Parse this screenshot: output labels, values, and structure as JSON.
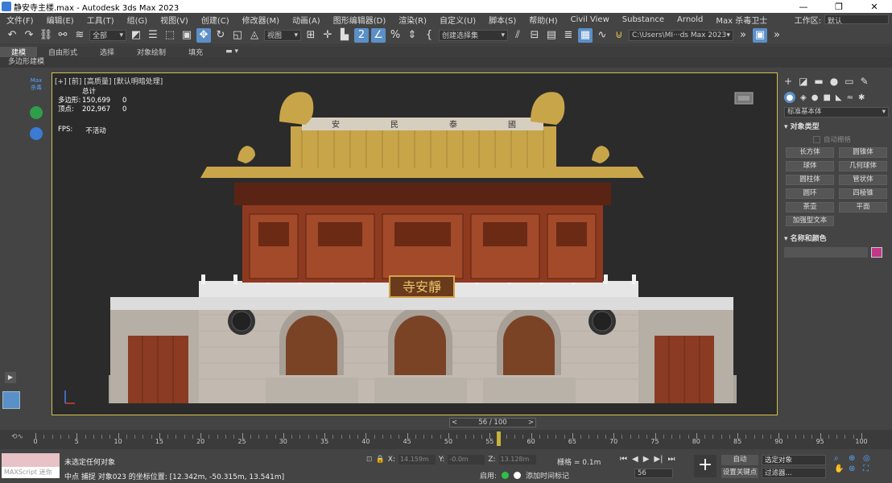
{
  "window": {
    "title": "静安寺主楼.max - Autodesk 3ds Max 2023",
    "controls": [
      "—",
      "❐",
      "✕"
    ]
  },
  "menu": {
    "items": [
      "文件(F)",
      "编辑(E)",
      "工具(T)",
      "组(G)",
      "视图(V)",
      "创建(C)",
      "修改器(M)",
      "动画(A)",
      "图形编辑器(D)",
      "渲染(R)",
      "自定义(U)",
      "脚本(S)",
      "帮助(H)",
      "Civil View",
      "Substance",
      "Arnold",
      "Max 杀毒卫士"
    ],
    "workspace_label": "工作区:",
    "workspace_value": "默认"
  },
  "toolbar": {
    "filter": "全部",
    "ref_coord": "视图",
    "named_selection": "创建选择集",
    "path": "C:\\Users\\MI···ds Max 2023"
  },
  "ribbon": {
    "tabs": [
      "建模",
      "自由形式",
      "选择",
      "对象绘制",
      "填充"
    ],
    "active_tab": "建模",
    "sub": "多边形建模"
  },
  "left": {
    "badge_line1": "Max",
    "badge_line2": "杀毒"
  },
  "viewport": {
    "label": "[+] [前] [高质量] [默认明暗处理]",
    "stats_title": "总计",
    "polys_label": "多边形:",
    "polys_total": "150,699",
    "polys_sel": "0",
    "verts_label": "顶点:",
    "verts_total": "202,967",
    "verts_sel": "0",
    "fps_label": "FPS:",
    "fps_value": "不活动",
    "plaque_text": "寺安靜",
    "board_chars": [
      "安",
      "民",
      "泰",
      "國"
    ]
  },
  "command_panel": {
    "category": "标准基本体",
    "rollout_object_type": "对象类型",
    "autogrid": "自动栅格",
    "objects": [
      "长方体",
      "圆锥体",
      "球体",
      "几何球体",
      "圆柱体",
      "管状体",
      "圆环",
      "四棱锥",
      "茶壶",
      "平面",
      "加强型文本"
    ],
    "rollout_name_color": "名称和颜色",
    "object_color": "#c2378a"
  },
  "timeline": {
    "slider_text": "56 / 100",
    "current_frame": 56,
    "start": 0,
    "end": 100,
    "labels": [
      0,
      5,
      10,
      15,
      20,
      25,
      30,
      35,
      40,
      45,
      50,
      55,
      60,
      65,
      70,
      75,
      80,
      85,
      90,
      95,
      100
    ]
  },
  "status": {
    "script_placeholder": "MAXScript 迷你",
    "selection": "未选定任何对象",
    "prompt": "中点 捕捉 对象023 的坐标位置: [12.342m, -50.315m, 13.541m]",
    "x_label": "X:",
    "x_value": "14.159m",
    "y_label": "Y:",
    "y_value": "-0.0m",
    "z_label": "Z:",
    "z_value": "13.128m",
    "grid": "栅格 = 0.1m",
    "enable_label": "启用:",
    "add_time_tag": "添加时间标记",
    "frame": "56",
    "auto_key": "自动",
    "set_key": "设置关键点",
    "sel_set": "选定对象",
    "filters": "过滤器..."
  }
}
